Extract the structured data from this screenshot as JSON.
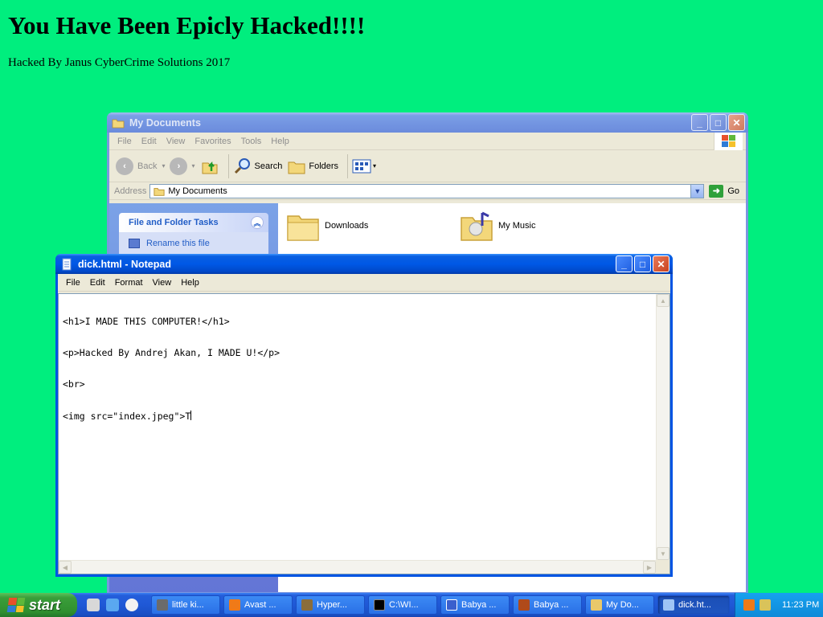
{
  "page": {
    "heading": "You Have Been Epicly Hacked!!!!",
    "subheading": "Hacked By Janus CyberCrime Solutions 2017"
  },
  "explorer": {
    "title": "My Documents",
    "menu": [
      "File",
      "Edit",
      "View",
      "Favorites",
      "Tools",
      "Help"
    ],
    "toolbar": {
      "back": "Back",
      "search": "Search",
      "folders": "Folders"
    },
    "address": {
      "label": "Address",
      "value": "My Documents",
      "go": "Go"
    },
    "tasks": {
      "header": "File and Folder Tasks",
      "items": [
        "Rename this file"
      ]
    },
    "items": [
      {
        "name": "Downloads",
        "icon": "folder-icon"
      },
      {
        "name": "My Music",
        "icon": "music-folder-icon"
      }
    ]
  },
  "notepad": {
    "title": "dick.html - Notepad",
    "menu": [
      "File",
      "Edit",
      "Format",
      "View",
      "Help"
    ],
    "lines": [
      "<h1>I MADE THIS COMPUTER!</h1>",
      "<p>Hacked By Andrej Akan, I MADE U!</p>",
      "<br>",
      "<img src=\"index.jpeg\">T"
    ]
  },
  "taskbar": {
    "start": "start",
    "tasks": [
      {
        "label": "little ki...",
        "icon": "raccoon-icon",
        "color": "#6b6b6b"
      },
      {
        "label": "Avast ...",
        "icon": "avast-icon",
        "color": "#f07a18"
      },
      {
        "label": "Hyper...",
        "icon": "hyperterminal-icon",
        "color": "#8a6d3b"
      },
      {
        "label": "C:\\WI...",
        "icon": "cmd-icon",
        "color": "#000000"
      },
      {
        "label": "Babya ...",
        "icon": "babya-icon",
        "color": "#3a5fcd"
      },
      {
        "label": "Babya ...",
        "icon": "film-icon",
        "color": "#b04a1a"
      },
      {
        "label": "My Do...",
        "icon": "explorer-folder-icon",
        "color": "#e8c86a"
      },
      {
        "label": "dick.ht...",
        "icon": "notepad-icon",
        "color": "#9ec4f5",
        "active": true
      }
    ],
    "clock": "11:23 PM"
  },
  "colors": {
    "desktop": "#00ee7e",
    "xp_blue": "#0054e3",
    "start_green": "#3a9e3a"
  }
}
